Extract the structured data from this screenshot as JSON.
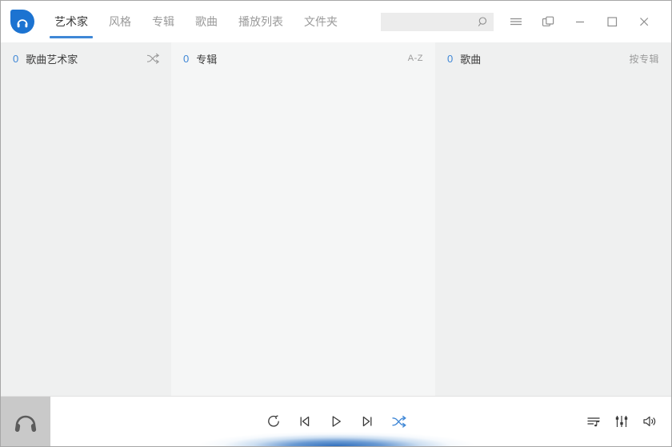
{
  "colors": {
    "accent": "#3f87d6",
    "logo_blue": "#1c73d1"
  },
  "topbar": {
    "tabs": [
      {
        "label": "艺术家",
        "active": true
      },
      {
        "label": "风格",
        "active": false
      },
      {
        "label": "专辑",
        "active": false
      },
      {
        "label": "歌曲",
        "active": false
      },
      {
        "label": "播放列表",
        "active": false
      },
      {
        "label": "文件夹",
        "active": false
      }
    ],
    "search": {
      "value": ""
    }
  },
  "columns": {
    "artists": {
      "count": "0",
      "label": "歌曲艺术家"
    },
    "albums": {
      "count": "0",
      "label": "专辑",
      "sort_label": "A-Z"
    },
    "songs": {
      "count": "0",
      "label": "歌曲",
      "sort_label": "按专辑"
    }
  },
  "icons": {
    "logo": "headphones",
    "search": "magnifier",
    "menu": "hamburger-lines",
    "mini_player": "overlapping-squares",
    "minimize": "minus",
    "maximize": "square",
    "close": "x",
    "artists_header": "shuffle-arrows",
    "loop": "circular-arrow",
    "previous": "bar-left-triangle",
    "play": "right-triangle-outline",
    "next": "right-triangle-bar",
    "shuffle": "crossed-arrows",
    "queue": "list-with-music-note",
    "equalizer": "vertical-sliders",
    "volume": "speaker-with-waves",
    "now_playing_placeholder": "headphones"
  }
}
